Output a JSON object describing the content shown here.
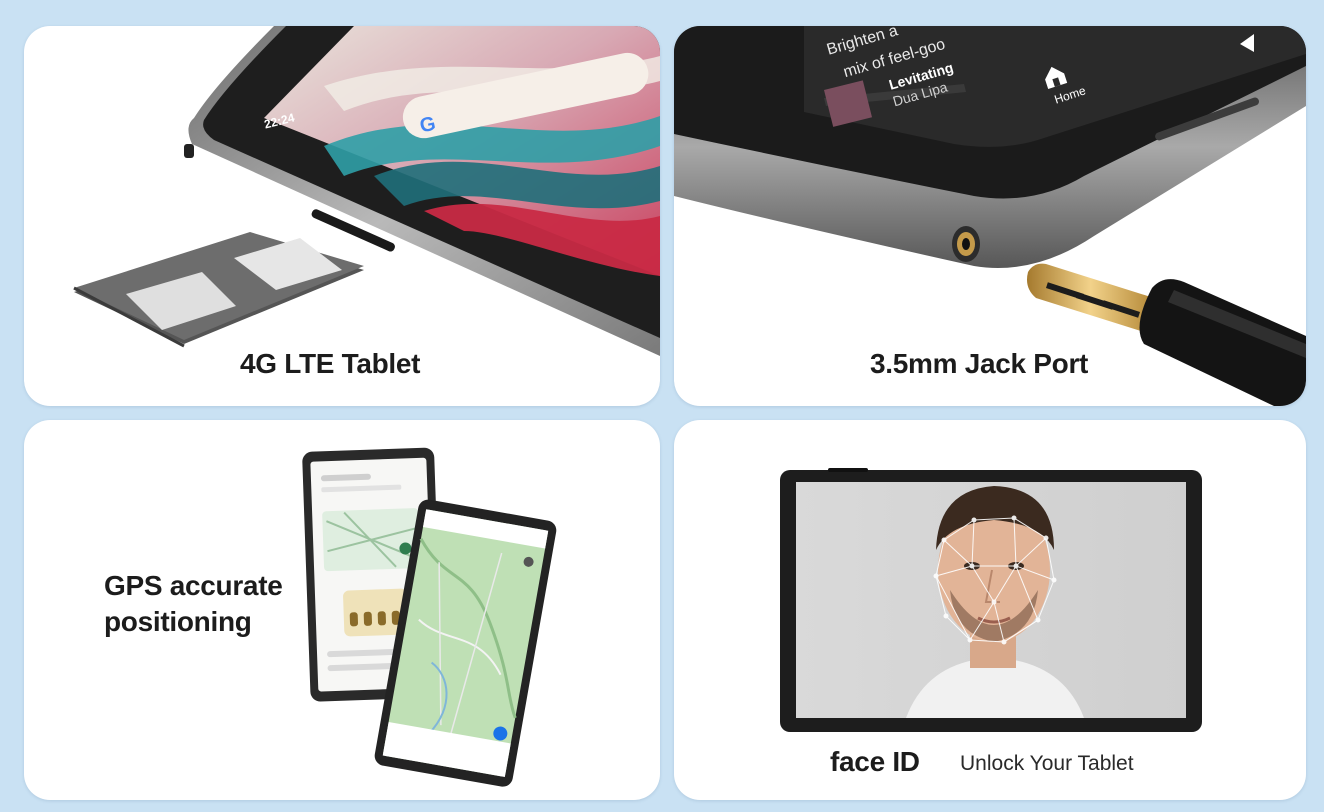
{
  "panels": {
    "lte": {
      "caption": "4G LTE Tablet",
      "clock": "22:24",
      "search_logo": "G"
    },
    "jack": {
      "caption": "3.5mm Jack Port",
      "promo_text_1": "Brighten a",
      "promo_text_2": "mix of feel-goo",
      "song_title": "Levitating",
      "song_artist": "Dua Lipa",
      "nav_home": "Home"
    },
    "gps": {
      "caption_line1": "GPS accurate",
      "caption_line2": "positioning"
    },
    "face": {
      "caption_main": "face ID",
      "caption_sub": "Unlock Your Tablet"
    }
  },
  "colors": {
    "background": "#c9e1f3",
    "card": "#ffffff",
    "text": "#1c1c1c",
    "tablet_body": "#2b2b2b",
    "map_green": "#bfe0b5"
  },
  "icons": [
    "sim-tray-icon",
    "google-logo-icon",
    "home-icon",
    "audio-jack-icon",
    "map-pin-icon"
  ]
}
